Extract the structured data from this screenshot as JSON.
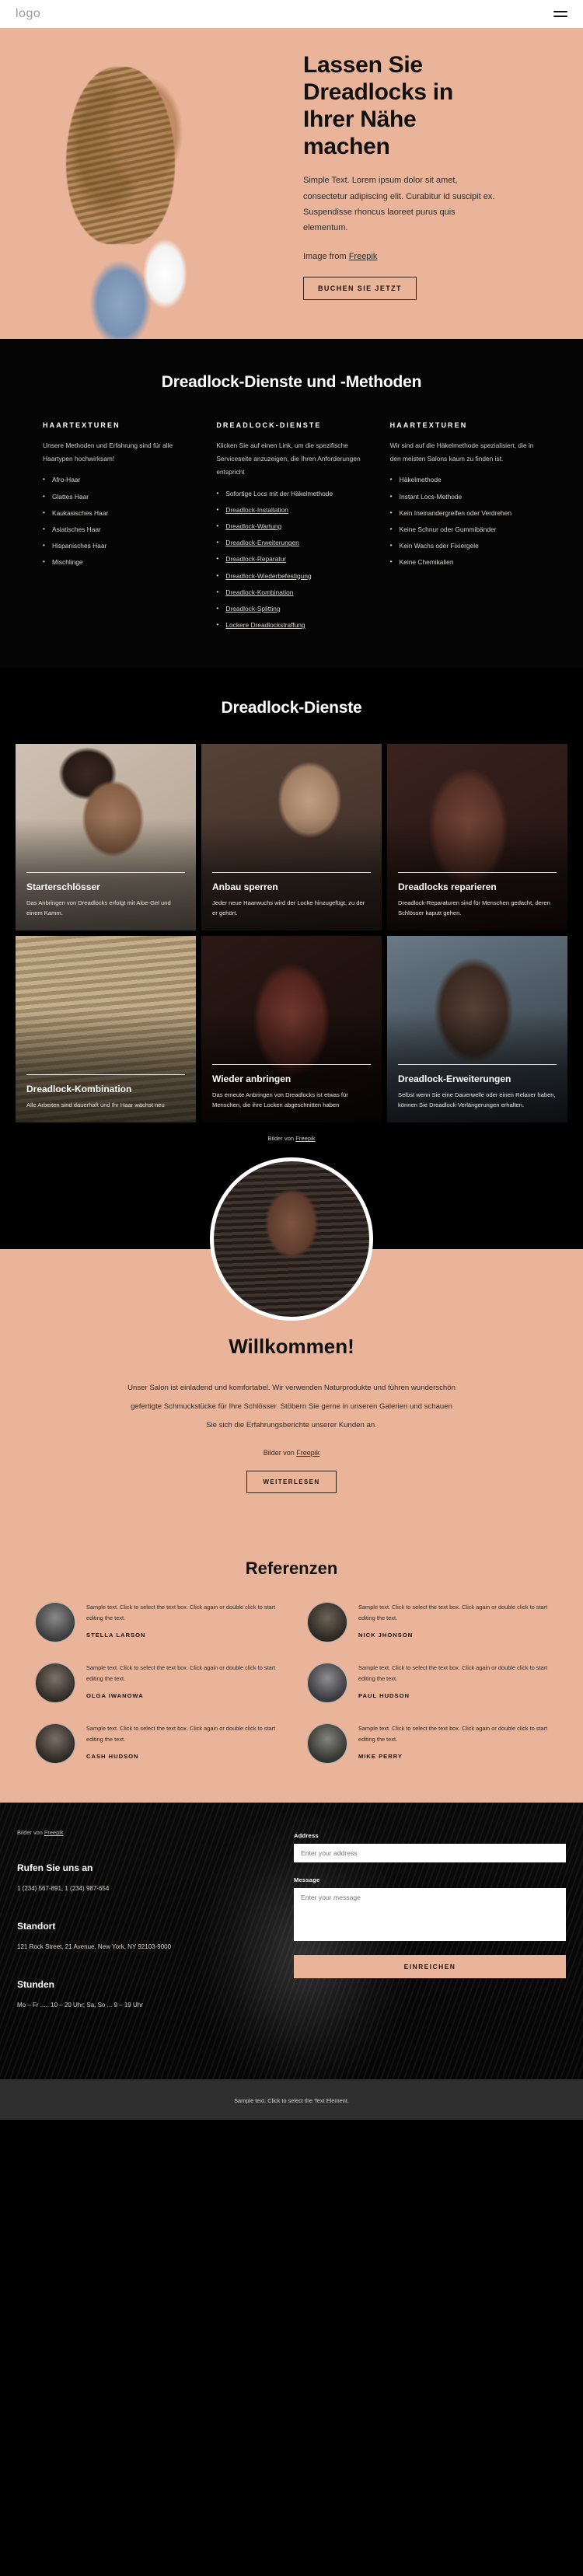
{
  "header": {
    "logo": "logo",
    "menu_icon": "hamburger-menu-icon"
  },
  "hero": {
    "title": "Lassen Sie Dreadlocks in Ihrer Nähe machen",
    "paragraph": "Simple Text. Lorem ipsum dolor sit amet, consectetur adipiscing elit. Curabitur id suscipit ex. Suspendisse rhoncus laoreet purus quis elementum.",
    "credit_prefix": "Image from ",
    "credit_link": "Freepik",
    "cta": "BUCHEN SIE JETZT"
  },
  "methods": {
    "title": "Dreadlock-Dienste und -Methoden",
    "columns": [
      {
        "heading": "HAARTEXTUREN",
        "intro": "Unsere Methoden und Erfahrung sind für alle Haartypen hochwirksam!",
        "items": [
          {
            "label": "Afro-Haar",
            "link": false
          },
          {
            "label": "Glattes Haar",
            "link": false
          },
          {
            "label": "Kaukasisches Haar",
            "link": false
          },
          {
            "label": "Asiatisches Haar",
            "link": false
          },
          {
            "label": "Hispanisches Haar",
            "link": false
          },
          {
            "label": "Mischlinge",
            "link": false
          }
        ]
      },
      {
        "heading": "DREADLOCK-DIENSTE",
        "intro": "Klicken Sie auf einen Link, um die spezifische Serviceseite anzuzeigen, die Ihren Anforderungen entspricht",
        "items": [
          {
            "label": "Sofortige Locs mit der Häkelmethode",
            "link": false
          },
          {
            "label": "Dreadlock-Installation",
            "link": true
          },
          {
            "label": "Dreadlock-Wartung",
            "link": true
          },
          {
            "label": "Dreadlock-Erweiterungen",
            "link": true
          },
          {
            "label": "Dreadlock-Reparatur",
            "link": true
          },
          {
            "label": "Dreadlock-Wiederbefestigung",
            "link": true
          },
          {
            "label": "Dreadlock-Kombination",
            "link": true
          },
          {
            "label": "Dreadlock-Splitting",
            "link": true
          },
          {
            "label": "Lockere Dreadlockstraffung",
            "link": true
          }
        ]
      },
      {
        "heading": "HAARTEXTUREN",
        "intro": "Wir sind auf die Häkelmethode spezialisiert, die in den meisten Salons kaum zu finden ist.",
        "items": [
          {
            "label": "Häkelmethode",
            "link": false
          },
          {
            "label": "Instant Locs-Methode",
            "link": false
          },
          {
            "label": "Kein Ineinandergreifen oder Verdrehen",
            "link": false
          },
          {
            "label": "Keine Schnur oder Gummibänder",
            "link": false
          },
          {
            "label": "Kein Wachs oder Fixiergele",
            "link": false
          },
          {
            "label": "Keine Chemikalien",
            "link": false
          }
        ]
      }
    ]
  },
  "gallery": {
    "title": "Dreadlock-Dienste",
    "cards": [
      {
        "title": "Starterschlösser",
        "desc": "Das Anbringen von Dreadlocks erfolgt mit Aloe-Gel und einem Kamm."
      },
      {
        "title": "Anbau sperren",
        "desc": "Jeder neue Haarwuchs wird der Locke hinzugefügt, zu der er gehört."
      },
      {
        "title": "Dreadlocks reparieren",
        "desc": "Dreadlock-Reparaturen sind für Menschen gedacht, deren Schlösser kaputt gehen."
      },
      {
        "title": "Dreadlock-Kombination",
        "desc": "Alle Arbeiten sind dauerhaft und Ihr Haar wächst neu"
      },
      {
        "title": "Wieder anbringen",
        "desc": "Das erneute Anbringen von Dreadlocks ist etwas für Menschen, die ihre Locken abgeschnitten haben"
      },
      {
        "title": "Dreadlock-Erweiterungen",
        "desc": "Selbst wenn Sie eine Dauerwelle oder einen Relaxer haben, können Sie Dreadlock-Verlängerungen erhalten."
      }
    ],
    "credit_prefix": "Bilder von ",
    "credit_link": "Freepik"
  },
  "welcome": {
    "title": "Willkommen!",
    "paragraph": "Unser Salon ist einladend und komfortabel. Wir verwenden Naturprodukte und führen wunderschön gefertigte Schmuckstücke für Ihre Schlösser. Stöbern Sie gerne in unseren Galerien und schauen Sie sich die Erfahrungsberichte unserer Kunden an.",
    "credit_prefix": "Bilder von ",
    "credit_link": "Freepik",
    "cta": "WEITERLESEN"
  },
  "testimonials": {
    "title": "Referenzen",
    "items": [
      {
        "text": "Sample text. Click to select the text box. Click again or double click to start editing the text.",
        "name": "STELLA LARSON"
      },
      {
        "text": "Sample text. Click to select the text box. Click again or double click to start editing the text.",
        "name": "NICK JHONSON"
      },
      {
        "text": "Sample text. Click to select the text box. Click again or double click to start editing the text.",
        "name": "OLGA IWANOWA"
      },
      {
        "text": "Sample text. Click to select the text box. Click again or double click to start editing the text.",
        "name": "PAUL HUDSON"
      },
      {
        "text": "Sample text. Click to select the text box. Click again or double click to start editing the text.",
        "name": "CASH HUDSON"
      },
      {
        "text": "Sample text. Click to select the text box. Click again or double click to start editing the text.",
        "name": "MIKE PERRY"
      }
    ]
  },
  "contact": {
    "credit_prefix": "Bilder von ",
    "credit_link": "Freepik",
    "phone_heading": "Rufen Sie uns an",
    "phone_value": "1 (234) 567-891, 1 (234) 987-654",
    "location_heading": "Standort",
    "location_value": "121 Rock Street, 21 Avenue, New York, NY 92103-9000",
    "hours_heading": "Stunden",
    "hours_value": "Mo – Fr ..... 10 – 20 Uhr; Sa, So ... 9 – 19 Uhr",
    "address_label": "Address",
    "address_placeholder": "Enter your address",
    "message_label": "Message",
    "message_placeholder": "Enter your message",
    "submit": "EINREICHEN"
  },
  "bottom": {
    "text": "Sample text. Click to select the Text Element."
  },
  "colors": {
    "accent": "#eab49a",
    "dark": "#050505",
    "bottom_bar": "#2f2f2f"
  }
}
